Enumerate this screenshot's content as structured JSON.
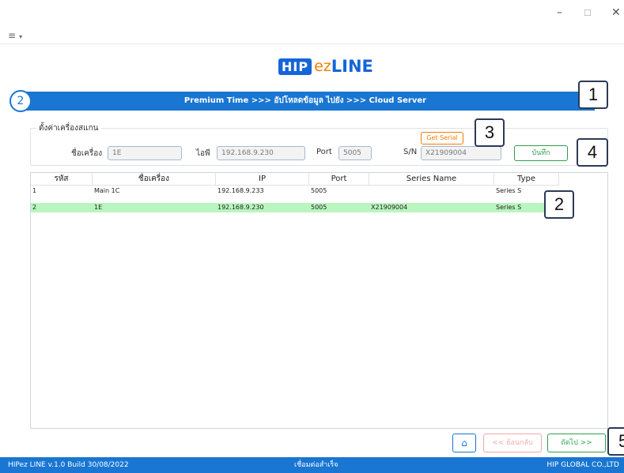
{
  "window": {
    "minimize_glyph": "–",
    "maximize_glyph": "☐",
    "close_glyph": "✕"
  },
  "menu": {
    "glyph": "≡",
    "caret": "▾"
  },
  "logo": {
    "part1": "HIP",
    "part2": "ez",
    "part3": "LINE"
  },
  "header": {
    "step_number": "2",
    "title": "Premium Time >>> อัปโหลดข้อมูล ไปยัง >>> Cloud Server"
  },
  "settings": {
    "legend": "ตั้งค่าเครื่องสแกน",
    "machine_name_label": "ชื่อเครื่อง",
    "machine_name_value": "1E",
    "ip_label": "ไอพี",
    "ip_value": "192.168.9.230",
    "port_label": "Port",
    "port_value": "5005",
    "sn_label": "S/N",
    "sn_value": "X21909004",
    "get_serial_label": "Get Serial",
    "save_label": "บันทึก"
  },
  "table": {
    "columns": [
      "รหัส",
      "ชื่อเครื่อง",
      "IP",
      "Port",
      "Series Name",
      "Type"
    ],
    "rows": [
      {
        "id": "1",
        "name": "Main 1C",
        "ip": "192.168.9.233",
        "port": "5005",
        "series_name": "",
        "type": "Series S"
      },
      {
        "id": "2",
        "name": "1E",
        "ip": "192.168.9.230",
        "port": "5005",
        "series_name": "X21909004",
        "type": "Series S"
      }
    ],
    "selected_row_index": 1
  },
  "buttons": {
    "home_icon": "⌂",
    "back_label": "<< ย้อนกลับ",
    "next_label": "ถัดไป >>"
  },
  "status_bar": {
    "version": "HIPez LINE v.1.0  Build 30/08/2022",
    "connection": "เชื่อมต่อสำเร็จ",
    "company": "HIP GLOBAL CO.,LTD"
  },
  "callouts": [
    "1",
    "2",
    "3",
    "4",
    "5"
  ],
  "colors": {
    "brand_blue": "#1976d2",
    "accent_orange": "#f57c00",
    "save_green": "#2e9e4f",
    "selected_row": "#b9f5bf",
    "back_pink": "#f4a8a8"
  }
}
